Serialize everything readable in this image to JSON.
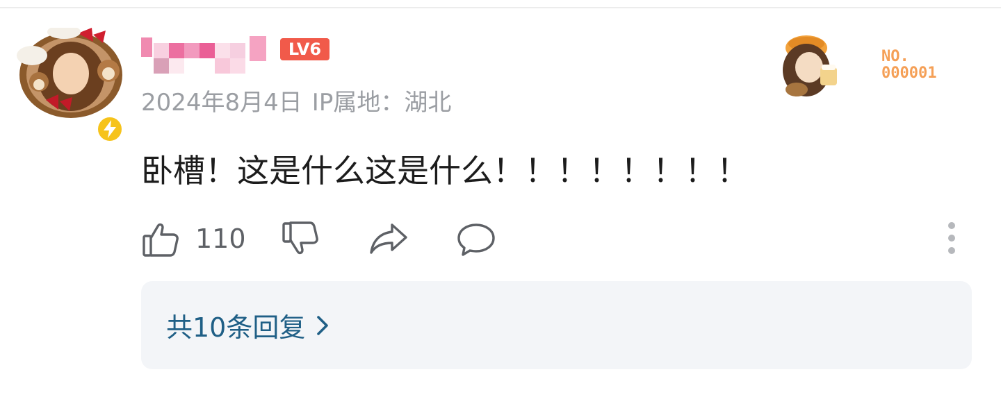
{
  "comment": {
    "date": "2024年8月4日",
    "ip_location": "IP属地：湖北",
    "level": "LV6",
    "text": "卧槽！这是什么这是什么！！！！！！！！",
    "likes": "110",
    "replies_label": "共10条回复",
    "deco_label_top": "NO.",
    "deco_label_bottom": "000001"
  },
  "colors": {
    "accent_link": "#1f5f86",
    "level_badge": "#f15a4a",
    "verified": "#f6c31b",
    "meta_gray": "#9b9ea3",
    "deco_orange": "#f5a057"
  },
  "icons": {
    "like": "thumbs-up-icon",
    "dislike": "thumbs-down-icon",
    "share": "share-icon",
    "comment": "comment-bubble-icon",
    "more": "more-vertical-icon",
    "chevron": "chevron-right-icon",
    "verified": "lightning-icon"
  }
}
